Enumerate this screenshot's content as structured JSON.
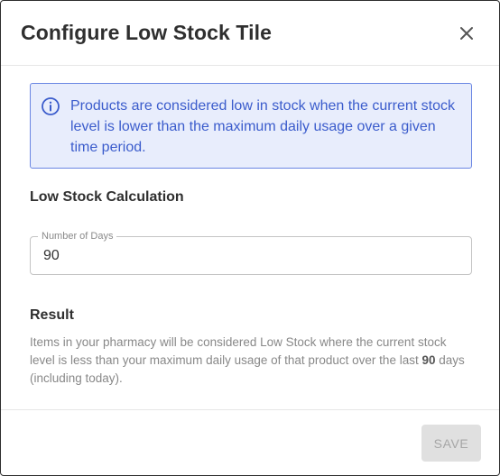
{
  "dialog": {
    "title": "Configure Low Stock Tile",
    "close_icon": "close-icon"
  },
  "info": {
    "icon": "info-circle-icon",
    "text": "Products are considered low in stock when the current stock level is lower than the maximum daily usage over a given time period."
  },
  "calculation": {
    "heading": "Low Stock Calculation",
    "days_field": {
      "label": "Number of Days",
      "value": "90"
    }
  },
  "result": {
    "heading": "Result",
    "text_before": "Items in your pharmacy will be considered Low Stock where the current stock level is less than your maximum daily usage of that product over the last ",
    "days": "90",
    "text_after": " days (including today)."
  },
  "footer": {
    "save_label": "SAVE"
  },
  "colors": {
    "info_background": "#e8edfc",
    "info_border": "#6a86e3",
    "info_text": "#3b5ccc",
    "save_disabled_bg": "#e0e0e0",
    "save_disabled_text": "#a6a6a6"
  }
}
